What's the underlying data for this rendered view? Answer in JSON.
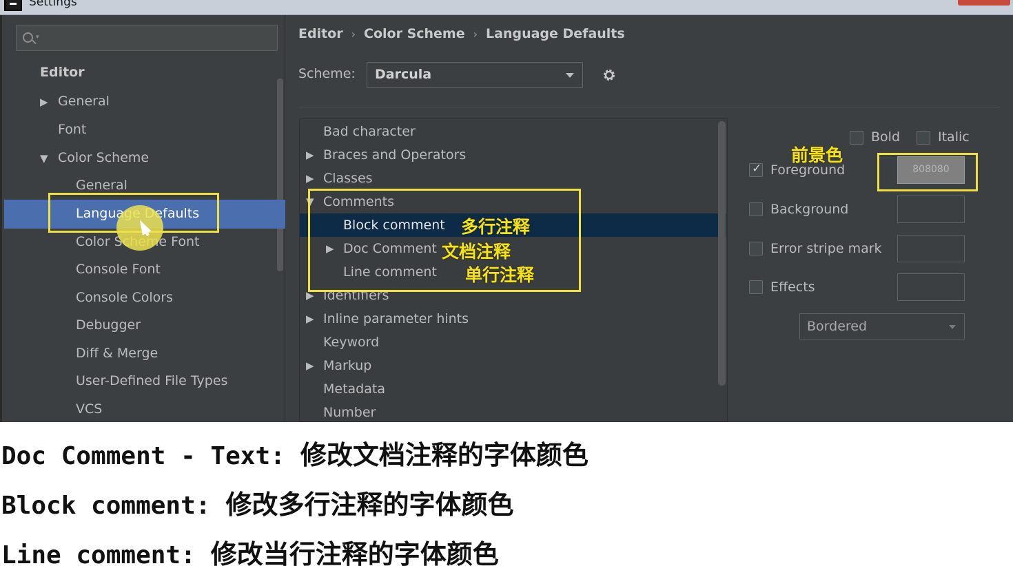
{
  "window": {
    "title": "Settings"
  },
  "search": {
    "placeholder": ""
  },
  "sidebar": {
    "header": "Editor",
    "items": [
      {
        "label": "General",
        "arrow": "▶"
      },
      {
        "label": "Font",
        "arrow": ""
      },
      {
        "label": "Color Scheme",
        "arrow": "▼"
      },
      {
        "label": "General",
        "arrow": ""
      },
      {
        "label": "Language Defaults",
        "arrow": "",
        "selected": true
      },
      {
        "label": "Color Scheme Font",
        "arrow": ""
      },
      {
        "label": "Console Font",
        "arrow": ""
      },
      {
        "label": "Console Colors",
        "arrow": ""
      },
      {
        "label": "Debugger",
        "arrow": ""
      },
      {
        "label": "Diff & Merge",
        "arrow": ""
      },
      {
        "label": "User-Defined File Types",
        "arrow": ""
      },
      {
        "label": "VCS",
        "arrow": ""
      }
    ]
  },
  "breadcrumb": {
    "items": [
      "Editor",
      "Color Scheme",
      "Language Defaults"
    ],
    "separator": "›"
  },
  "scheme": {
    "label": "Scheme:",
    "value": "Darcula"
  },
  "tree": {
    "nodes": [
      {
        "label": "Bad character",
        "arrow": ""
      },
      {
        "label": "Braces and Operators",
        "arrow": "▶"
      },
      {
        "label": "Classes",
        "arrow": "▶"
      },
      {
        "label": "Comments",
        "arrow": "▼"
      },
      {
        "label": "Block comment",
        "arrow": "",
        "selected": true
      },
      {
        "label": "Doc Comment",
        "arrow": "▶"
      },
      {
        "label": "Line comment",
        "arrow": ""
      },
      {
        "label": "Identifiers",
        "arrow": "▶"
      },
      {
        "label": "Inline parameter hints",
        "arrow": "▶"
      },
      {
        "label": "Keyword",
        "arrow": ""
      },
      {
        "label": "Markup",
        "arrow": "▶"
      },
      {
        "label": "Metadata",
        "arrow": ""
      },
      {
        "label": "Number",
        "arrow": ""
      }
    ]
  },
  "annotations": {
    "block": "多行注释",
    "doc": "文档注释",
    "line": "单行注释",
    "foreground": "前景色"
  },
  "options": {
    "bold": "Bold",
    "italic": "Italic",
    "foreground": {
      "label": "Foreground",
      "checked": true,
      "color": "808080"
    },
    "background": {
      "label": "Background",
      "checked": false
    },
    "error_stripe": {
      "label": "Error stripe mark",
      "checked": false
    },
    "effects": {
      "label": "Effects",
      "checked": false,
      "type": "Bordered"
    }
  },
  "captions": [
    {
      "key": "Doc Comment - Text:",
      "desc": "修改文档注释的字体颜色"
    },
    {
      "key": "Block comment:",
      "desc": "修改多行注释的字体颜色"
    },
    {
      "key": "Line comment:",
      "desc": "修改当行注释的字体颜色"
    }
  ],
  "colors": {
    "selection": "#4b6eaf",
    "tree_selection": "#0d2a47",
    "annotation": "#f5e11a",
    "background": "#3c3f41"
  }
}
